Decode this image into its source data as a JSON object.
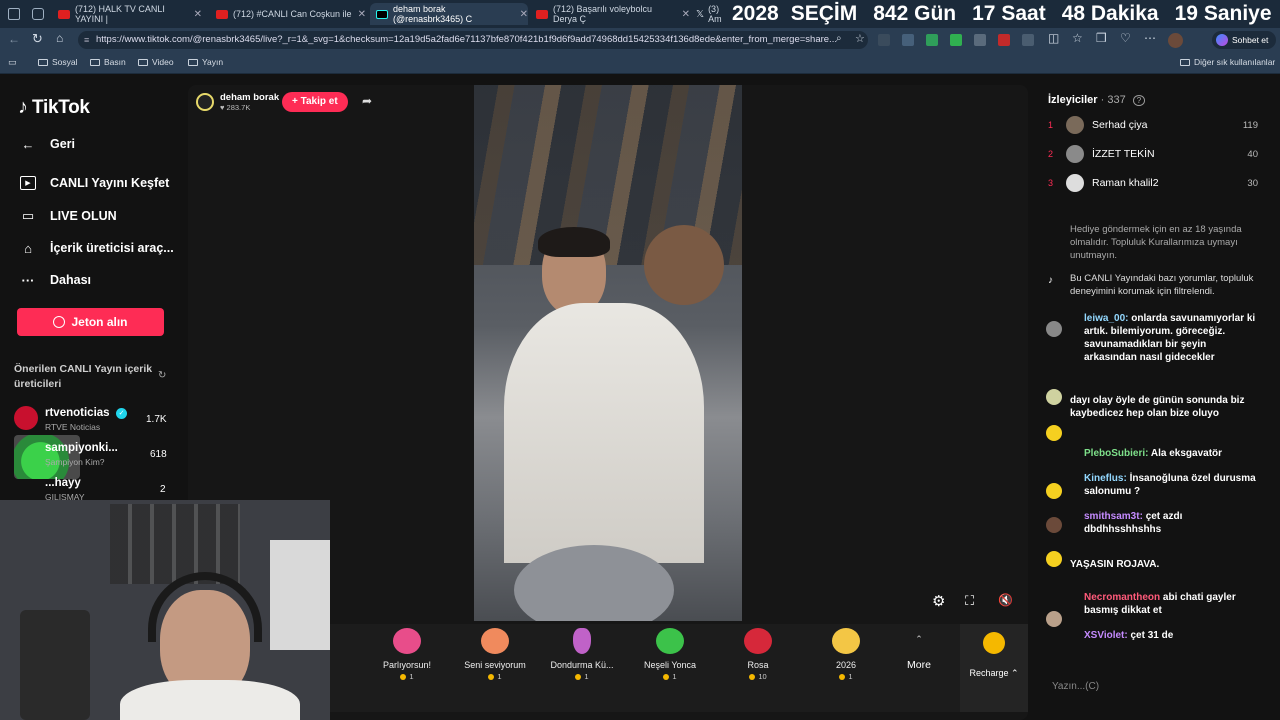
{
  "browser": {
    "tabs": [
      {
        "title": "(712) HALK TV CANLI YAYINI |"
      },
      {
        "title": "(712) #CANLI Can Coşkun ile"
      },
      {
        "title": "deham borak (@renasbrk3465) C"
      },
      {
        "title": "(712) Başarılı voleybolcu Derya Ç"
      },
      {
        "title": "(3) Am"
      }
    ],
    "url": "https://www.tiktok.com/@renasbrk3465/live?_r=1&_svg=1&checksum=12a19d5a2fad6e71137bfe870f421b1f9d6f9add74968dd15425334f136d8ede&enter_from_merge=share...",
    "profile_label": "Sohbet et",
    "bookmarks": [
      "Sosyal",
      "Basın",
      "Video",
      "Yayın"
    ],
    "other_bookmarks": "Diğer sık kullanılanlar"
  },
  "countdown": {
    "year": "2028",
    "label": "SEÇİM",
    "days": "842",
    "days_unit": "Gün",
    "hours": "17",
    "hours_unit": "Saat",
    "minutes": "48",
    "minutes_unit": "Dakika",
    "seconds": "19",
    "seconds_unit": "Saniye"
  },
  "sidebar": {
    "logo": "TikTok",
    "back": "Geri",
    "items": [
      "CANLI Yayını Keşfet",
      "LIVE OLUN",
      "İçerik üreticisi araç...",
      "Dahası"
    ],
    "coin_button": "Jeton alın",
    "suggested_title": "Önerilen CANLI Yayın içerik üreticileri",
    "suggested": [
      {
        "name": "rtvenoticias",
        "sub": "RTVE Noticias",
        "count": "1.7K"
      },
      {
        "name": "sampiyonki...",
        "sub": "Şampiyon Kim?",
        "count": "618"
      },
      {
        "name": "...hayy",
        "sub": "GILISMAY",
        "count": "2"
      }
    ]
  },
  "host": {
    "name": "deham borak",
    "likes": "283.7K",
    "follow": "Takip et"
  },
  "gifts": [
    {
      "name": "Parlıyorsun!",
      "price": "1",
      "color": "#e84d8a"
    },
    {
      "name": "Seni seviyorum",
      "price": "1",
      "color": "#f08a5d"
    },
    {
      "name": "Dondurma Kü...",
      "price": "1",
      "color": "#c062c8"
    },
    {
      "name": "Neşeli Yonca",
      "price": "1",
      "color": "#3cc24a"
    },
    {
      "name": "Rosa",
      "price": "10",
      "color": "#d6283a"
    },
    {
      "name": "2026",
      "price": "1",
      "color": "#f3c645"
    }
  ],
  "gift_more": "More",
  "recharge": "Recharge",
  "chat": {
    "viewers_label": "İzleyiciler",
    "viewers_count": "337",
    "top_viewers": [
      {
        "rank": "1",
        "name": "Serhad çiya",
        "count": "119"
      },
      {
        "rank": "2",
        "name": "İZZET TEKİN",
        "count": "40"
      },
      {
        "rank": "3",
        "name": "Raman khalil2",
        "count": "30"
      }
    ],
    "notice_age": "Hediye göndermek için en az 18 yaşında olmalıdır. Topluluk Kurallarımıza uymayı unutmayın.",
    "notice_filter": "Bu CANLI Yayındaki bazı yorumlar, topluluk deneyimini korumak için filtrelendi.",
    "messages": [
      {
        "name": "leiwa_00:",
        "text": "onlarda savunamıyorlar ki artık. bilemiyorum. göreceğiz. savunamadıkları bir şeyin arkasından nasıl gidecekler"
      },
      {
        "name": "",
        "text": "dayı olay öyle de günün sonunda biz kaybedicez hep olan bize oluyo"
      },
      {
        "name": "PleboSubieri:",
        "text": "Ala eksgavatör"
      },
      {
        "name": "Kineflus:",
        "text": "İnsanoğluna özel durusma salonumu ?"
      },
      {
        "name": "smithsam3t:",
        "text": "çet azdı dbdhhsshhshhs"
      },
      {
        "name": "",
        "text": "YAŞASIN ROJAVA."
      },
      {
        "name": "Necromantheon",
        "text": "abi chati gayler basmış dikkat et"
      },
      {
        "name": "XSViolet:",
        "text": "çet 31 de"
      }
    ],
    "input_placeholder": "Yazın...(C)"
  }
}
